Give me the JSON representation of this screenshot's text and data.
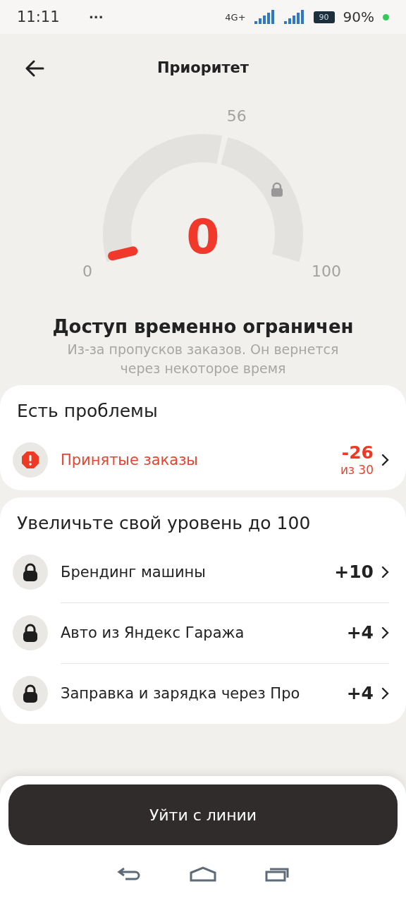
{
  "status_bar": {
    "time": "11:11",
    "more": "···",
    "network": "4G+",
    "battery": "90",
    "battery_percent": "90%"
  },
  "header": {
    "title": "Приоритет"
  },
  "gauge": {
    "value": "0",
    "min_label": "0",
    "threshold_label": "56",
    "max_label": "100",
    "upper_locked": true
  },
  "status": {
    "title": "Доступ временно ограничен",
    "subtitle": "Из-за пропусков заказов. Он вернется через некоторое время"
  },
  "sections": [
    {
      "title": "Есть проблемы",
      "items": [
        {
          "kind": "problem",
          "label": "Принятые заказы",
          "value": "-26",
          "sub": "из 30"
        }
      ]
    },
    {
      "title": "Увеличьте свой уровень до 100",
      "items": [
        {
          "kind": "locked",
          "label": "Брендинг машины",
          "value": "+10"
        },
        {
          "kind": "locked",
          "label": "Авто из Яндекс Гаража",
          "value": "+4"
        },
        {
          "kind": "locked",
          "label": "Заправка и зарядка через Про",
          "value": "+4"
        }
      ]
    }
  ],
  "action_button": "Уйти с линии"
}
